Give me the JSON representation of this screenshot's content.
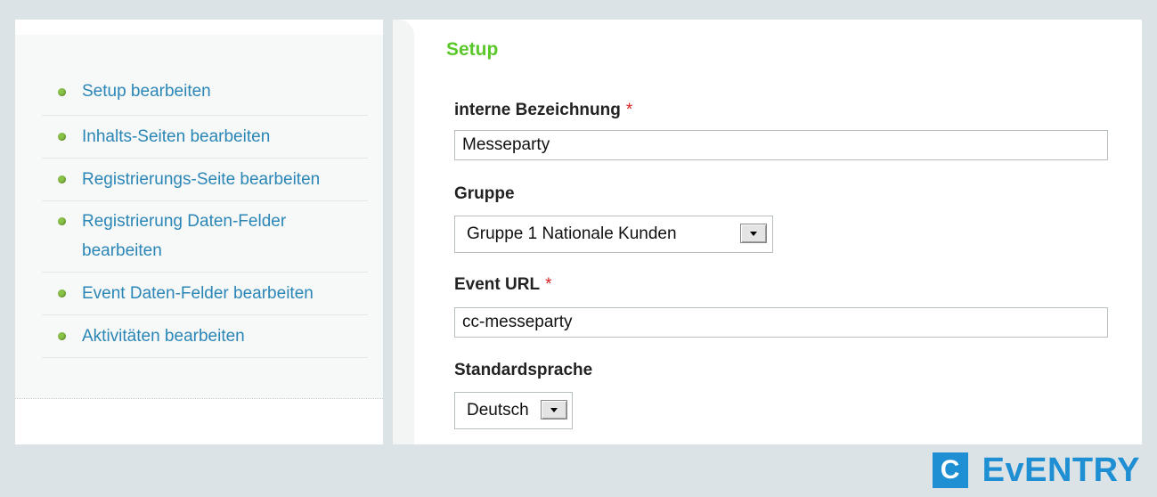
{
  "sidebar": {
    "items": [
      {
        "label": "Setup bearbeiten"
      },
      {
        "label": "Inhalts-Seiten bearbeiten"
      },
      {
        "label": "Registrierungs-Seite bearbeiten"
      },
      {
        "label": "Registrierung Daten-Felder bearbeiten"
      },
      {
        "label": "Event Daten-Felder bearbeiten"
      },
      {
        "label": "Aktivitäten bearbeiten"
      }
    ]
  },
  "form": {
    "title": "Setup",
    "required_marker": "*",
    "internal_name": {
      "label": "interne Bezeichnung",
      "value": "Messeparty"
    },
    "group": {
      "label": "Gruppe",
      "value": "Gruppe 1 Nationale Kunden"
    },
    "event_url": {
      "label": "Event URL",
      "value": "cc-messeparty"
    },
    "language": {
      "label": "Standardsprache",
      "value": "Deutsch"
    }
  },
  "logo": {
    "mark": "C",
    "text": "EvENTRY"
  },
  "colors": {
    "accent_green": "#5bc82a",
    "link_blue": "#2a86b6",
    "brand_blue": "#1f8fd3",
    "required_red": "#d62020"
  },
  "icons": [
    "bullet-icon",
    "dropdown-arrow-icon"
  ]
}
